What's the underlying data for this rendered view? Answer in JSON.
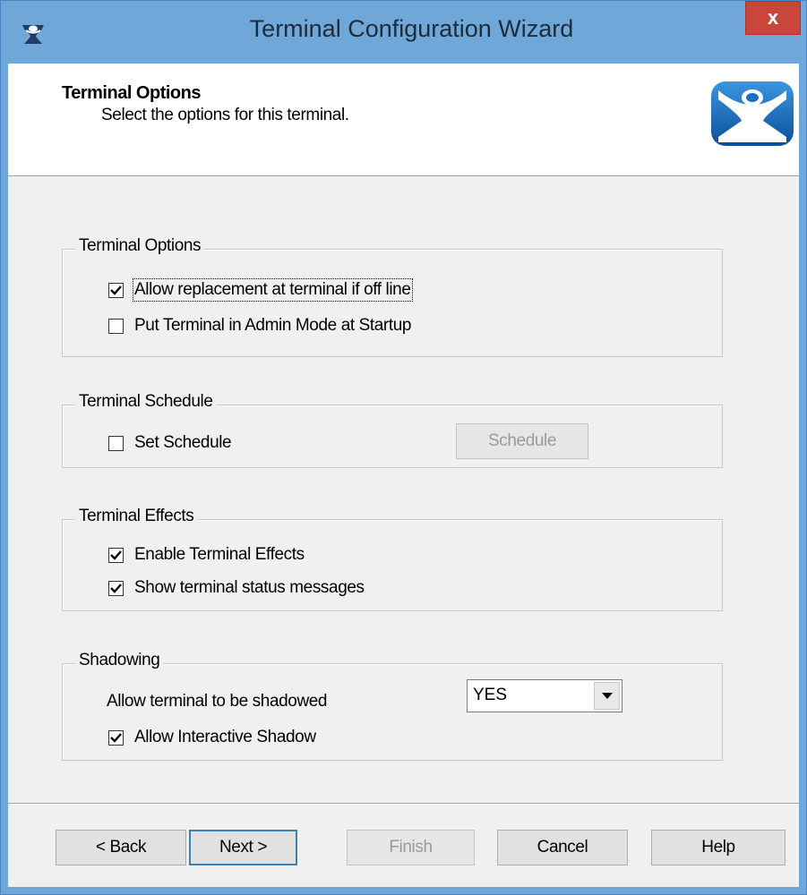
{
  "window": {
    "title": "Terminal Configuration Wizard",
    "close_label": "x"
  },
  "header": {
    "title": "Terminal Options",
    "subtitle": "Select the options for this terminal."
  },
  "terminal_options": {
    "label": "Terminal Options",
    "allow_replacement": {
      "label": "Allow replacement at terminal if off line",
      "checked": true
    },
    "admin_mode": {
      "label": "Put Terminal in Admin Mode at Startup",
      "checked": false
    }
  },
  "terminal_schedule": {
    "label": "Terminal Schedule",
    "set_schedule": {
      "label": "Set Schedule",
      "checked": false
    },
    "schedule_button": "Schedule"
  },
  "terminal_effects": {
    "label": "Terminal Effects",
    "enable_effects": {
      "label": "Enable Terminal Effects",
      "checked": true
    },
    "status_messages": {
      "label": "Show terminal status messages",
      "checked": true
    }
  },
  "shadowing": {
    "label": "Shadowing",
    "allow_shadow_label": "Allow terminal to be shadowed",
    "allow_shadow_value": "YES",
    "interactive_shadow": {
      "label": "Allow Interactive Shadow",
      "checked": true
    }
  },
  "buttons": {
    "back": "< Back",
    "next": "Next >",
    "finish": "Finish",
    "cancel": "Cancel",
    "help": "Help"
  },
  "colors": {
    "window_frame": "#6fa7d9",
    "close_button": "#c9463a",
    "logo_blue": "#1a6fc0"
  }
}
